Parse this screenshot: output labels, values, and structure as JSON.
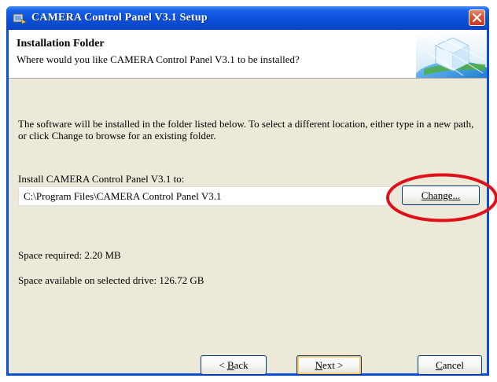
{
  "window": {
    "title": "CAMERA Control Panel V3.1 Setup"
  },
  "header": {
    "title": "Installation Folder",
    "subtitle": "Where would you like CAMERA Control Panel V3.1 to be installed?"
  },
  "body": {
    "description": "The software will be installed in the folder listed below. To select a different location, either type in a new path, or click Change to browse for an existing folder.",
    "install_label": "Install CAMERA Control Panel V3.1 to:",
    "install_path": "C:\\Program Files\\CAMERA Control Panel V3.1",
    "change_label": "Change...",
    "space_required": "Space required: 2.20 MB",
    "space_available": "Space available on selected drive: 126.72 GB"
  },
  "buttons": {
    "back": {
      "prefix": "< ",
      "mnemonic": "B",
      "rest": "ack"
    },
    "next": {
      "mnemonic": "N",
      "rest": "ext >"
    },
    "cancel": {
      "mnemonic": "C",
      "rest": "ancel"
    }
  },
  "colors": {
    "titlebar": "#0a4fd6",
    "dialog_bg": "#ece9d8",
    "annotation": "#e0101a"
  },
  "icons": [
    "setup-icon",
    "close-icon",
    "header-cube-graphic"
  ]
}
